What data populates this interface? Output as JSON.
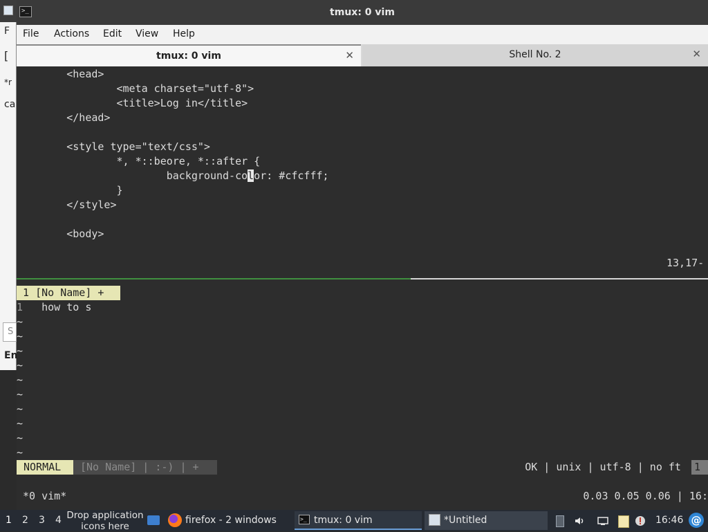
{
  "background_window": {
    "fragments": [
      "F",
      "[",
      "*r",
      "ca",
      "S",
      "En"
    ]
  },
  "window": {
    "title": "tmux: 0 vim"
  },
  "menubar": {
    "items": [
      "File",
      "Actions",
      "Edit",
      "View",
      "Help"
    ]
  },
  "tabs": [
    {
      "label": "tmux: 0 vim",
      "close": "✕"
    },
    {
      "label": "Shell No. 2",
      "close": "✕"
    }
  ],
  "upper_pane": {
    "lines": [
      "        <head>",
      "                <meta charset=\"utf-8\">",
      "                <title>Log in</title>",
      "        </head>",
      "",
      "        <style type=\"text/css\">",
      "                *, *::beore, *::after {",
      "                        background-co",
      "l",
      "or: #cfcfff;",
      "                }",
      "        </style>",
      "",
      "        <body>"
    ],
    "cursor_line_before": "                        background-co",
    "cursor_char": "l",
    "cursor_line_after": "or: #cfcfff;",
    "position": "13,17-"
  },
  "lower_pane": {
    "tabline": " 1 [No Name] + ",
    "line_number": "1",
    "line_text": "   how to s",
    "tilde": "~",
    "tilde_count": 10,
    "mode": "NORMAL",
    "filename": "[No Name] | :-) | +",
    "status_right": "OK | unix | utf-8 | no ft ",
    "status_end": "1"
  },
  "tmux_status": {
    "left": " *0 vim*",
    "right": "0.03 0.05 0.06 | 16:"
  },
  "taskbar": {
    "workspaces": [
      "1",
      "2",
      "3",
      "4"
    ],
    "drop_label": "Drop application icons here",
    "tasks": [
      {
        "label": "firefox - 2 windows"
      },
      {
        "label": "tmux: 0 vim"
      },
      {
        "label": "*Untitled"
      }
    ],
    "clock": "16:46",
    "debian_glyph": "@"
  }
}
